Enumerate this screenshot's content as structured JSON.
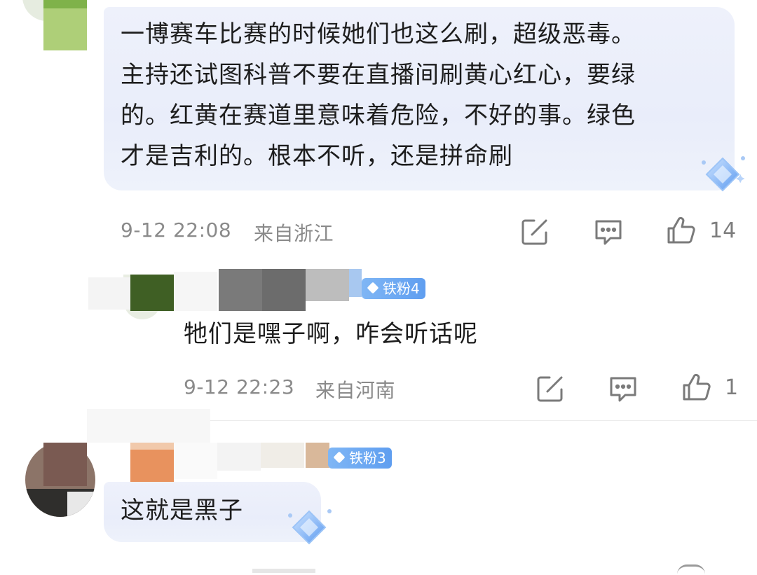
{
  "comments": [
    {
      "text_lines": [
        "一博赛车比赛的时候她们也这么刷，超级恶毒。",
        "主持还试图科普不要在直播间刷黄心红心，要绿",
        "的。红黄在赛道里意味着危险，不好的事。绿色",
        "才是吉利的。根本不听，还是拼命刷"
      ],
      "time": "9-12 22:08",
      "location": "来自浙江",
      "like_count": "14"
    },
    {
      "badge": "铁粉4",
      "text_lines": [
        "牠们是嘿子啊，咋会听话呢"
      ],
      "time": "9-12 22:23",
      "location": "来自河南",
      "like_count": "1"
    },
    {
      "badge": "铁粉3",
      "text_lines": [
        "这就是黑子"
      ]
    }
  ],
  "colors": {
    "bubble": "#eaeefa",
    "meta_text": "#8a8a8a",
    "badge": "#6aa6f2",
    "icon": "#7a7a7a"
  },
  "icons": {
    "repost": "edit-square-icon",
    "comment": "comment-bubble-icon",
    "like": "thumbs-up-icon",
    "sparkle": "diamond-sparkle-icon"
  }
}
